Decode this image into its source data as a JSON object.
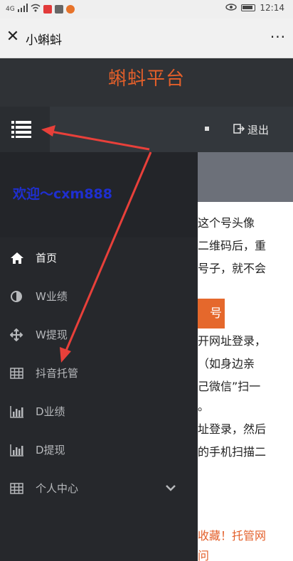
{
  "status_bar": {
    "signal": "4G",
    "time": "12:14"
  },
  "title_bar": {
    "title": "小蝌蚪",
    "more": "···"
  },
  "header": {
    "platform_title": "蝌蚪平台"
  },
  "top_nav": {
    "logout_label": "退出"
  },
  "sidebar": {
    "welcome": "欢迎～cxm888",
    "items": [
      {
        "label": "首页",
        "icon": "home-icon",
        "active": true
      },
      {
        "label": "W业绩",
        "icon": "half-circle-icon"
      },
      {
        "label": "W提现",
        "icon": "move-arrows-icon"
      },
      {
        "label": "抖音托管",
        "icon": "table-icon"
      },
      {
        "label": "D业绩",
        "icon": "bar-chart-icon"
      },
      {
        "label": "D提现",
        "icon": "bar-chart-icon"
      },
      {
        "label": "个人中心",
        "icon": "table-icon",
        "has_dropdown": true
      }
    ]
  },
  "content": {
    "lines": [
      "这个号头像",
      "二维码后，重",
      "号子，就不会"
    ],
    "button_label": "号",
    "lines2": [
      "开网址登录，",
      "（如身边亲",
      "己微信”扫一",
      "。",
      "址登录，然后",
      "的手机扫描二"
    ],
    "orange_lines": [
      "收藏！托管网",
      "问"
    ]
  },
  "colors": {
    "accent": "#e35f2a",
    "welcome": "#1f2fd0",
    "annotation": "#e8403a"
  }
}
